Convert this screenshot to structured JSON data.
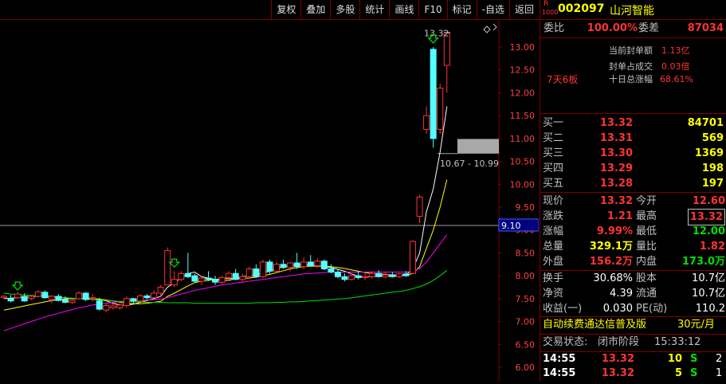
{
  "toolbar": {
    "items": [
      "复权",
      "叠加",
      "多股",
      "统计",
      "画线",
      "F10",
      "标记",
      "-自选",
      "返回"
    ]
  },
  "ticker": {
    "badge_top": "R",
    "badge_bottom": "1000",
    "code": "002097",
    "name": "山河智能"
  },
  "quote": {
    "weibi_label": "委比",
    "weibi_value": "100.00%",
    "weicha_label": "委差",
    "weicha_value": "87034",
    "seal_amount_label": "当前封单额",
    "seal_amount_value": "1.13亿",
    "seal_ratio_label": "封单占成交",
    "seal_ratio_value": "0.03倍",
    "streak": "7天6板",
    "ten_day_label": "十日总涨幅",
    "ten_day_value": "68.61%",
    "bids": [
      {
        "label": "买一",
        "price": "13.32",
        "vol": "84701"
      },
      {
        "label": "买二",
        "price": "13.31",
        "vol": "569"
      },
      {
        "label": "买三",
        "price": "13.30",
        "vol": "1369"
      },
      {
        "label": "买四",
        "price": "13.29",
        "vol": "198"
      },
      {
        "label": "买五",
        "price": "13.28",
        "vol": "197"
      }
    ],
    "stats": [
      {
        "l1": "现价",
        "v1": "13.32",
        "c1": "red",
        "l2": "今开",
        "v2": "12.60",
        "c2": "red",
        "b2": false
      },
      {
        "l1": "涨跌",
        "v1": "1.21",
        "c1": "red",
        "l2": "最高",
        "v2": "13.32",
        "c2": "red",
        "b2": true
      },
      {
        "l1": "涨幅",
        "v1": "9.99%",
        "c1": "red",
        "l2": "最低",
        "v2": "12.00",
        "c2": "green",
        "b2": false
      },
      {
        "l1": "总量",
        "v1": "329.1万",
        "c1": "yel",
        "l2": "量比",
        "v2": "1.82",
        "c2": "red",
        "b2": false
      },
      {
        "l1": "外盘",
        "v1": "156.2万",
        "c1": "red",
        "l2": "内盘",
        "v2": "173.0万",
        "c2": "green",
        "b2": false
      }
    ],
    "fundamentals": [
      {
        "l1": "换手",
        "v1": "30.68%",
        "l2": "股本",
        "v2": "10.7亿"
      },
      {
        "l1": "净资",
        "v1": "4.39",
        "l2": "流通",
        "v2": "10.7亿"
      },
      {
        "l1": "收益(一)",
        "v1": "0.030",
        "l2": "PE(动)",
        "v2": "110.2"
      }
    ],
    "promo_text": "自动续费通达信普及版",
    "promo_price": "30元/月",
    "status_label": "交易状态:",
    "status_value": "闭市阶段",
    "status_time": "15:33:12",
    "ticks": [
      {
        "time": "14:55",
        "price": "13.32",
        "vol": "10",
        "side": "S",
        "count": "2"
      },
      {
        "time": "14:55",
        "price": "13.32",
        "vol": "5",
        "side": "S",
        "count": "1"
      }
    ]
  },
  "chart_data": {
    "type": "candlestick",
    "ylim": [
      6.0,
      13.3
    ],
    "yticks": [
      "13.00",
      "12.50",
      "12.00",
      "11.50",
      "11.00",
      "10.50",
      "10.00",
      "9.50",
      "9.00",
      "8.50",
      "8.00",
      "7.50",
      "7.00",
      "6.50",
      "6.00"
    ],
    "ytick_values": [
      13.0,
      12.5,
      12.0,
      11.5,
      11.0,
      10.5,
      10.0,
      9.5,
      9.0,
      8.5,
      8.0,
      7.5,
      7.0,
      6.5,
      6.0
    ],
    "current_line": {
      "value": 9.1,
      "label": "9.10"
    },
    "high_label": "13.32",
    "zone": {
      "low": 10.67,
      "high": 10.99,
      "label": "10.67 - 10.99"
    },
    "candles": [
      {
        "o": 7.52,
        "h": 7.58,
        "l": 7.5,
        "c": 7.55
      },
      {
        "o": 7.5,
        "h": 7.58,
        "l": 7.42,
        "c": 7.45
      },
      {
        "o": 7.52,
        "h": 7.65,
        "l": 7.5,
        "c": 7.6
      },
      {
        "o": 7.55,
        "h": 7.62,
        "l": 7.43,
        "c": 7.45
      },
      {
        "o": 7.5,
        "h": 7.58,
        "l": 7.46,
        "c": 7.55
      },
      {
        "o": 7.55,
        "h": 7.68,
        "l": 7.52,
        "c": 7.65
      },
      {
        "o": 7.64,
        "h": 7.68,
        "l": 7.5,
        "c": 7.52
      },
      {
        "o": 7.48,
        "h": 7.58,
        "l": 7.4,
        "c": 7.55
      },
      {
        "o": 7.55,
        "h": 7.6,
        "l": 7.44,
        "c": 7.46
      },
      {
        "o": 7.48,
        "h": 7.55,
        "l": 7.4,
        "c": 7.42
      },
      {
        "o": 7.42,
        "h": 7.5,
        "l": 7.38,
        "c": 7.46
      },
      {
        "o": 7.5,
        "h": 7.66,
        "l": 7.48,
        "c": 7.62
      },
      {
        "o": 7.62,
        "h": 7.64,
        "l": 7.45,
        "c": 7.48
      },
      {
        "o": 7.5,
        "h": 7.6,
        "l": 7.45,
        "c": 7.52
      },
      {
        "o": 7.45,
        "h": 7.52,
        "l": 7.24,
        "c": 7.27
      },
      {
        "o": 7.25,
        "h": 7.4,
        "l": 7.2,
        "c": 7.35
      },
      {
        "o": 7.3,
        "h": 7.4,
        "l": 7.26,
        "c": 7.34
      },
      {
        "o": 7.3,
        "h": 7.4,
        "l": 7.25,
        "c": 7.36
      },
      {
        "o": 7.35,
        "h": 7.55,
        "l": 7.3,
        "c": 7.5
      },
      {
        "o": 7.5,
        "h": 7.52,
        "l": 7.4,
        "c": 7.45
      },
      {
        "o": 7.45,
        "h": 7.6,
        "l": 7.44,
        "c": 7.56
      },
      {
        "o": 7.56,
        "h": 7.6,
        "l": 7.48,
        "c": 7.52
      },
      {
        "o": 7.52,
        "h": 7.68,
        "l": 7.5,
        "c": 7.62
      },
      {
        "o": 7.62,
        "h": 7.8,
        "l": 7.55,
        "c": 7.75
      },
      {
        "o": 7.8,
        "h": 8.62,
        "l": 7.8,
        "c": 8.55
      },
      {
        "o": 7.8,
        "h": 8.1,
        "l": 7.75,
        "c": 7.92
      },
      {
        "o": 7.92,
        "h": 8.1,
        "l": 7.88,
        "c": 8.05
      },
      {
        "o": 8.05,
        "h": 8.5,
        "l": 7.95,
        "c": 7.98
      },
      {
        "o": 8.0,
        "h": 8.05,
        "l": 7.86,
        "c": 7.88
      },
      {
        "o": 7.88,
        "h": 8.0,
        "l": 7.8,
        "c": 7.95
      },
      {
        "o": 7.95,
        "h": 8.1,
        "l": 7.88,
        "c": 7.92
      },
      {
        "o": 7.92,
        "h": 8.0,
        "l": 7.8,
        "c": 7.86
      },
      {
        "o": 7.86,
        "h": 8.0,
        "l": 7.82,
        "c": 7.96
      },
      {
        "o": 7.96,
        "h": 8.1,
        "l": 7.9,
        "c": 8.05
      },
      {
        "o": 8.05,
        "h": 8.15,
        "l": 7.9,
        "c": 7.92
      },
      {
        "o": 7.92,
        "h": 8.05,
        "l": 7.85,
        "c": 7.98
      },
      {
        "o": 7.98,
        "h": 8.2,
        "l": 7.95,
        "c": 8.15
      },
      {
        "o": 8.15,
        "h": 8.25,
        "l": 7.95,
        "c": 7.98
      },
      {
        "o": 7.98,
        "h": 8.35,
        "l": 7.95,
        "c": 8.3
      },
      {
        "o": 8.3,
        "h": 8.35,
        "l": 8.05,
        "c": 8.1
      },
      {
        "o": 8.1,
        "h": 8.3,
        "l": 8.05,
        "c": 8.25
      },
      {
        "o": 8.25,
        "h": 8.35,
        "l": 8.15,
        "c": 8.18
      },
      {
        "o": 8.18,
        "h": 8.3,
        "l": 8.1,
        "c": 8.28
      },
      {
        "o": 8.28,
        "h": 8.5,
        "l": 8.15,
        "c": 8.2
      },
      {
        "o": 8.2,
        "h": 8.4,
        "l": 8.15,
        "c": 8.3
      },
      {
        "o": 8.3,
        "h": 8.45,
        "l": 8.2,
        "c": 8.22
      },
      {
        "o": 8.22,
        "h": 8.38,
        "l": 8.18,
        "c": 8.32
      },
      {
        "o": 8.32,
        "h": 8.35,
        "l": 8.12,
        "c": 8.15
      },
      {
        "o": 8.15,
        "h": 8.25,
        "l": 8.05,
        "c": 8.08
      },
      {
        "o": 8.08,
        "h": 8.15,
        "l": 7.95,
        "c": 7.98
      },
      {
        "o": 7.98,
        "h": 8.05,
        "l": 7.88,
        "c": 7.92
      },
      {
        "o": 7.92,
        "h": 8.05,
        "l": 7.9,
        "c": 8.0
      },
      {
        "o": 8.0,
        "h": 8.1,
        "l": 7.92,
        "c": 7.96
      },
      {
        "o": 7.96,
        "h": 8.05,
        "l": 7.9,
        "c": 7.98
      },
      {
        "o": 7.98,
        "h": 8.1,
        "l": 7.94,
        "c": 8.05
      },
      {
        "o": 8.05,
        "h": 8.12,
        "l": 7.96,
        "c": 7.98
      },
      {
        "o": 7.98,
        "h": 8.08,
        "l": 7.94,
        "c": 8.02
      },
      {
        "o": 8.02,
        "h": 8.08,
        "l": 7.96,
        "c": 7.98
      },
      {
        "o": 7.98,
        "h": 8.06,
        "l": 7.95,
        "c": 8.04
      },
      {
        "o": 8.04,
        "h": 8.1,
        "l": 7.98,
        "c": 8.0
      },
      {
        "o": 8.05,
        "h": 8.78,
        "l": 8.05,
        "c": 8.75
      },
      {
        "o": 9.3,
        "h": 9.77,
        "l": 9.15,
        "c": 9.72
      },
      {
        "o": 11.2,
        "h": 11.7,
        "l": 11.1,
        "c": 11.5
      },
      {
        "o": 12.95,
        "h": 13.0,
        "l": 10.8,
        "c": 11.0
      },
      {
        "o": 11.2,
        "h": 12.2,
        "l": 11.1,
        "c": 12.1
      },
      {
        "o": 12.6,
        "h": 13.32,
        "l": 12.0,
        "c": 13.32
      }
    ],
    "ma": [
      {
        "name": "MA5",
        "color": "#ffffff",
        "values": [
          7.5,
          7.51,
          7.52,
          7.53,
          7.54,
          7.55,
          7.56,
          7.55,
          7.54,
          7.52,
          7.5,
          7.5,
          7.5,
          7.51,
          7.48,
          7.45,
          7.4,
          7.36,
          7.36,
          7.38,
          7.42,
          7.46,
          7.5,
          7.55,
          7.75,
          7.85,
          7.95,
          8.05,
          8.08,
          7.98,
          7.95,
          7.92,
          7.9,
          7.9,
          7.94,
          7.98,
          8.0,
          8.02,
          8.06,
          8.1,
          8.15,
          8.2,
          8.22,
          8.24,
          8.24,
          8.23,
          8.22,
          8.2,
          8.18,
          8.14,
          8.1,
          8.04,
          7.99,
          7.97,
          7.98,
          7.99,
          8.0,
          8.0,
          8.01,
          8.02,
          8.15,
          8.5,
          9.4,
          9.9,
          10.7,
          11.7
        ]
      },
      {
        "name": "MA10",
        "color": "#ffff00",
        "values": [
          7.25,
          7.28,
          7.31,
          7.34,
          7.37,
          7.4,
          7.43,
          7.46,
          7.48,
          7.5,
          7.5,
          7.5,
          7.5,
          7.5,
          7.49,
          7.47,
          7.45,
          7.42,
          7.4,
          7.39,
          7.39,
          7.4,
          7.42,
          7.44,
          7.55,
          7.62,
          7.7,
          7.78,
          7.85,
          7.88,
          7.9,
          7.92,
          7.94,
          7.94,
          7.94,
          7.94,
          7.95,
          7.97,
          8.0,
          8.03,
          8.07,
          8.11,
          8.15,
          8.18,
          8.2,
          8.21,
          8.21,
          8.21,
          8.2,
          8.18,
          8.16,
          8.13,
          8.1,
          8.07,
          8.05,
          8.04,
          8.03,
          8.02,
          8.01,
          8.01,
          8.05,
          8.2,
          8.6,
          9.0,
          9.5,
          10.1
        ]
      },
      {
        "name": "MA20",
        "color": "#ff00ff",
        "values": [
          6.8,
          6.85,
          6.9,
          6.95,
          7.0,
          7.05,
          7.1,
          7.14,
          7.18,
          7.22,
          7.26,
          7.3,
          7.33,
          7.36,
          7.38,
          7.4,
          7.42,
          7.43,
          7.44,
          7.45,
          7.46,
          7.47,
          7.48,
          7.49,
          7.52,
          7.56,
          7.6,
          7.64,
          7.68,
          7.71,
          7.74,
          7.77,
          7.8,
          7.82,
          7.84,
          7.86,
          7.88,
          7.9,
          7.92,
          7.94,
          7.96,
          7.98,
          8.0,
          8.02,
          8.04,
          8.05,
          8.06,
          8.07,
          8.08,
          8.08,
          8.08,
          8.08,
          8.08,
          8.08,
          8.08,
          8.08,
          8.08,
          8.08,
          8.08,
          8.08,
          8.1,
          8.16,
          8.3,
          8.5,
          8.7,
          8.9
        ]
      },
      {
        "name": "MA60",
        "color": "#00e000",
        "values": [
          7.62,
          7.6,
          7.59,
          7.58,
          7.57,
          7.56,
          7.55,
          7.54,
          7.53,
          7.52,
          7.51,
          7.5,
          7.49,
          7.48,
          7.47,
          7.46,
          7.45,
          7.44,
          7.44,
          7.43,
          7.43,
          7.42,
          7.42,
          7.42,
          7.41,
          7.41,
          7.41,
          7.41,
          7.4,
          7.4,
          7.4,
          7.4,
          7.4,
          7.4,
          7.4,
          7.4,
          7.4,
          7.41,
          7.41,
          7.41,
          7.42,
          7.42,
          7.43,
          7.43,
          7.44,
          7.45,
          7.46,
          7.47,
          7.48,
          7.49,
          7.5,
          7.52,
          7.54,
          7.56,
          7.58,
          7.6,
          7.62,
          7.64,
          7.66,
          7.68,
          7.72,
          7.76,
          7.82,
          7.9,
          8.0,
          8.12
        ]
      }
    ],
    "markers": [
      {
        "index": 2,
        "value": 7.62
      },
      {
        "index": 25,
        "value": 8.12
      },
      {
        "index": 63,
        "value": 13.02
      }
    ]
  }
}
